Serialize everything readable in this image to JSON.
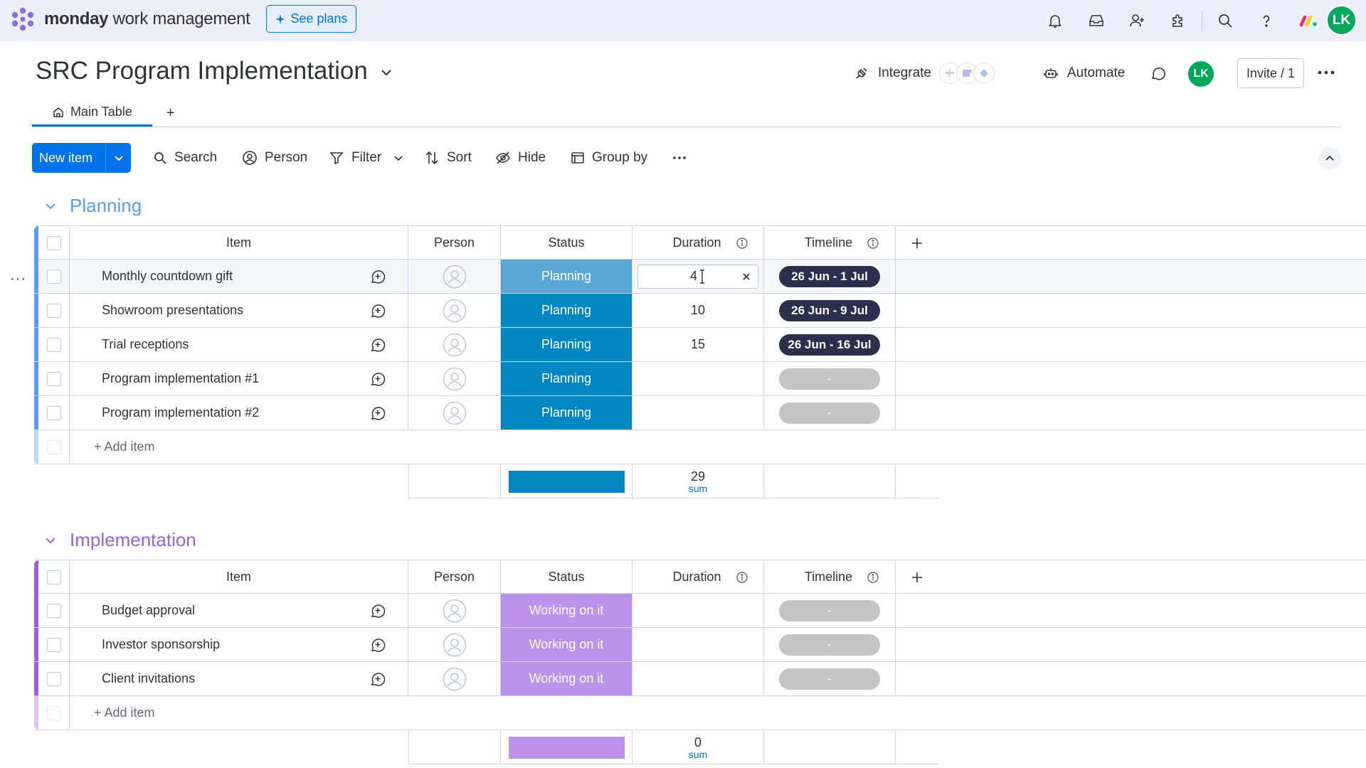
{
  "topbar": {
    "brand_bold": "monday",
    "brand_rest": " work management",
    "see_plans": "See plans",
    "avatar_initials": "LK",
    "icons": [
      "bell-icon",
      "inbox-icon",
      "invite-members-icon",
      "apps-icon",
      "search-icon",
      "help-icon",
      "monday-apps-icon"
    ]
  },
  "board": {
    "title": "SRC Program Implementation",
    "integrate": "Integrate",
    "automate": "Automate",
    "avatar_initials": "LK",
    "invite": "Invite / 1",
    "tabs": [
      {
        "label": "Main Table"
      }
    ],
    "tab_add": "+"
  },
  "toolbar": {
    "new_item": "New item",
    "search": "Search",
    "person": "Person",
    "filter": "Filter",
    "sort": "Sort",
    "hide": "Hide",
    "group_by": "Group by"
  },
  "columns": {
    "item": "Item",
    "person": "Person",
    "status": "Status",
    "duration": "Duration",
    "timeline": "Timeline"
  },
  "groups": [
    {
      "title": "Planning",
      "color": "#579bfc",
      "rows": [
        {
          "name": "Monthly countdown gift",
          "status": "Planning",
          "duration": "4",
          "timeline": "26 Jun - 1 Jul"
        },
        {
          "name": "Showroom presentations",
          "status": "Planning",
          "duration": "10",
          "timeline": "26 Jun - 9 Jul"
        },
        {
          "name": "Trial receptions",
          "status": "Planning",
          "duration": "15",
          "timeline": "26 Jun - 16 Jul"
        },
        {
          "name": "Program implementation #1",
          "status": "Planning",
          "duration": "",
          "timeline": "-"
        },
        {
          "name": "Program implementation #2",
          "status": "Planning",
          "duration": "",
          "timeline": "-"
        }
      ],
      "status_color": "#0086c0",
      "status_color_selected": "#5aa6d5",
      "add_item": "+ Add item",
      "summary": {
        "value": "29",
        "label": "sum"
      }
    },
    {
      "title": "Implementation",
      "color": "#a25ddc",
      "rows": [
        {
          "name": "Budget approval",
          "status": "Working on it",
          "duration": "",
          "timeline": "-"
        },
        {
          "name": "Investor sponsorship",
          "status": "Working on it",
          "duration": "",
          "timeline": "-"
        },
        {
          "name": "Client invitations",
          "status": "Working on it",
          "duration": "",
          "timeline": "-"
        }
      ],
      "status_color": "#bb93ec",
      "add_item": "+ Add item",
      "summary": {
        "value": "0",
        "label": "sum"
      }
    }
  ]
}
